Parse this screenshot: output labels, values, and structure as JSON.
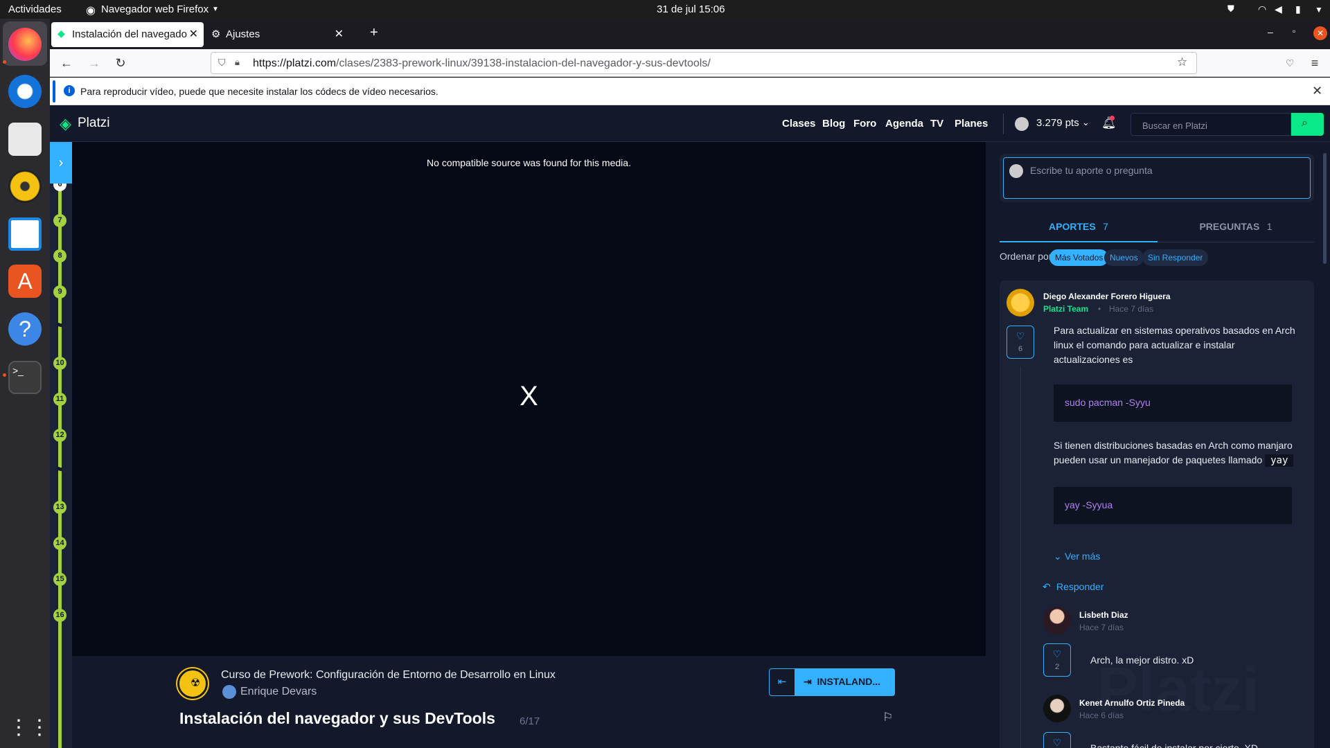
{
  "system": {
    "activities": "Actividades",
    "app_name": "Navegador web Firefox",
    "datetime": "31 de jul  15:06"
  },
  "browser": {
    "tabs": [
      {
        "label": "Instalación del navegado"
      },
      {
        "label": "Ajustes"
      }
    ],
    "url_domain": "https://platzi.com",
    "url_path": "/clases/2383-prework-linux/39138-instalacion-del-navegador-y-sus-devtools/",
    "notification": "Para reproducir vídeo, puede que necesite instalar los códecs de vídeo necesarios."
  },
  "header": {
    "logo": "Platzi",
    "nav": [
      "Clases",
      "Blog",
      "Foro",
      "Agenda",
      "TV",
      "Planes"
    ],
    "points": "3.279 pts",
    "search_placeholder": "Buscar en Platzi"
  },
  "timeline": {
    "nodes": [
      "6",
      "7",
      "8",
      "9",
      "10",
      "11",
      "12",
      "13",
      "14",
      "15",
      "16"
    ],
    "current": "6"
  },
  "video": {
    "message": "No compatible source was found for this media.",
    "close": "X"
  },
  "lesson": {
    "course": "Curso de Prework: Configuración de Entorno de Desarrollo en Linux",
    "teacher": "Enrique Devars",
    "title": "Instalación del navegador y sus DevTools",
    "progress": "6/17",
    "next_label": "INSTALAND..."
  },
  "sidebar": {
    "input_placeholder": "Escribe tu aporte o pregunta",
    "tabs": [
      {
        "label": "APORTES",
        "count": "7"
      },
      {
        "label": "PREGUNTAS",
        "count": "1"
      }
    ],
    "sort_label": "Ordenar por:",
    "sort_options": [
      "Más Votados",
      "Nuevos",
      "Sin Responder"
    ],
    "comment": {
      "author": "Diego Alexander Forero Higuera",
      "badge": "Platzi Team",
      "time": "Hace 7 días",
      "likes": "6",
      "text1": "Para actualizar en sistemas operativos basados en Arch linux el comando para actualizar e instalar actualizaciones es",
      "code1": "sudo pacman -Syyu",
      "text2a": "Si tienen distribuciones basadas en Arch como manjaro pueden usar un manejador de paquetes llamado",
      "inline_code": "yay",
      "code2": "yay -Syyua",
      "see_more": "Ver más",
      "reply": "Responder"
    },
    "replies": [
      {
        "author": "Lisbeth Diaz",
        "time": "Hace 7 días",
        "likes": "2",
        "text": "Arch, la mejor distro. xD"
      },
      {
        "author": "Kenet Arnulfo Ortiz Pineda",
        "time": "Hace 6 días",
        "text": "Bastante fácil de instalar por cierto. XD"
      }
    ],
    "watermark": "Platzi"
  },
  "colors": {
    "platzi_green": "#0ae98a",
    "accent_blue": "#33b1ff",
    "timeline_green": "#a3d13f",
    "page_bg": "#13192b"
  }
}
